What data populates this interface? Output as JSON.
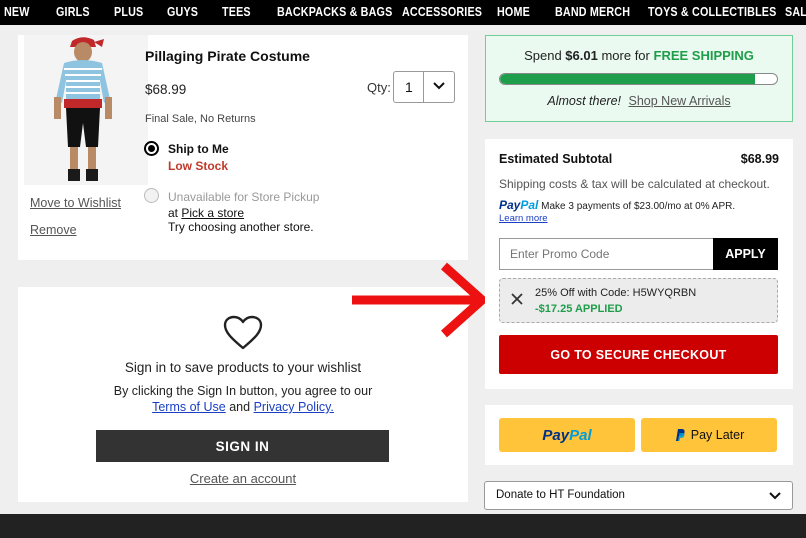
{
  "nav": {
    "items": [
      "NEW",
      "GIRLS",
      "PLUS",
      "GUYS",
      "TEES",
      "BACKPACKS & BAGS",
      "ACCESSORIES",
      "HOME",
      "BAND MERCH",
      "TOYS & COLLECTIBLES",
      "SALE"
    ]
  },
  "product": {
    "name": "Pillaging Pirate Costume",
    "price": "$68.99",
    "qty_label": "Qty:",
    "qty_value": "1",
    "final_sale": "Final Sale, No Returns",
    "ship_to_me": "Ship to Me",
    "low_stock": "Low Stock",
    "store_pickup": "Unavailable for Store Pickup",
    "pickup_at": "at",
    "pick_store_link": "Pick a store",
    "pickup_try": "Try choosing another store.",
    "move_to_wishlist": "Move to Wishlist",
    "remove": "Remove",
    "image_icon": "pirate-costume-photo"
  },
  "signin": {
    "icon": "heart-icon",
    "title": "Sign in to save products to your wishlist",
    "terms_line1": "By clicking the Sign In button, you agree to our",
    "terms_link": "Terms of Use",
    "terms_and": "and",
    "privacy_link": "Privacy Policy.",
    "button": "SIGN IN",
    "create_account": "Create an account"
  },
  "shipping": {
    "spend_prefix": "Spend",
    "spend_amount": "$6.01",
    "spend_middle": "more for",
    "free_shipping": "FREE SHIPPING",
    "progress_fraction": 0.92,
    "almost_there": "Almost there!",
    "shop_link": "Shop New Arrivals"
  },
  "summary": {
    "subtotal_label": "Estimated Subtotal",
    "subtotal_value": "$68.99",
    "shipping_note": "Shipping costs & tax will be calculated at checkout.",
    "paypal_pay": "Pay",
    "paypal_pal": "Pal",
    "paypal_offer": "Make 3 payments of $23.00/mo at 0% APR.",
    "learn_more": "Learn more",
    "promo_placeholder": "Enter Promo Code",
    "apply": "APPLY",
    "promo_code_text": "25% Off with Code: H5WYQRBN",
    "promo_discount": "-$17.25 APPLIED",
    "checkout": "GO TO SECURE CHECKOUT"
  },
  "payments": {
    "paypal_pay": "Pay",
    "paypal_pal": "Pal",
    "pay_later": "Pay Later"
  },
  "donate": {
    "selected": "Donate to HT Foundation"
  },
  "colors": {
    "accent_red": "#cc0000",
    "success_green": "#1e9e4a",
    "paypal_yellow": "#ffc439",
    "paypal_navy": "#003087",
    "paypal_blue": "#009cde"
  }
}
